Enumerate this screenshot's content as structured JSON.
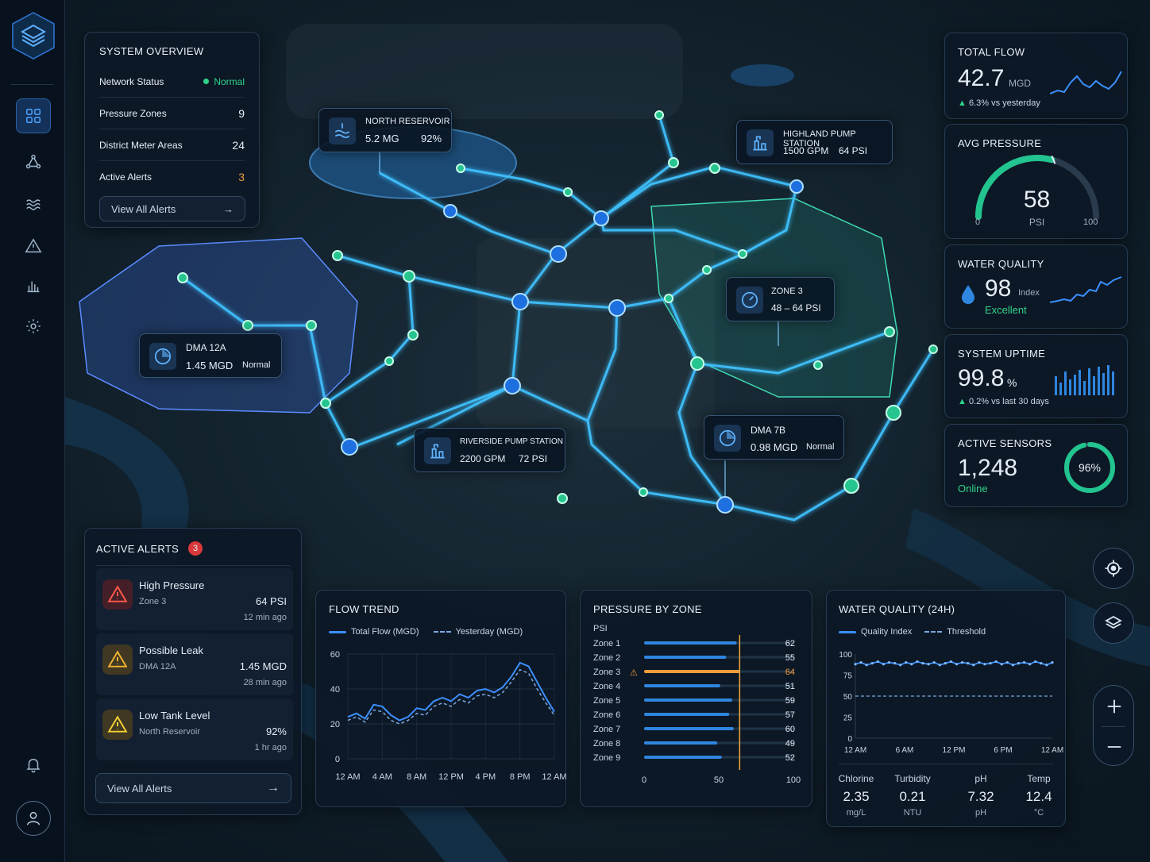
{
  "overview": {
    "title": "SYSTEM OVERVIEW",
    "rows": [
      {
        "label": "Network Status",
        "value": "Normal"
      },
      {
        "label": "Pressure Zones",
        "value": "9"
      },
      {
        "label": "District Meter Areas",
        "value": "24"
      },
      {
        "label": "Active Alerts",
        "value": "3"
      }
    ],
    "view_alerts": "View All Alerts"
  },
  "callouts": {
    "north_reservoir": {
      "title": "NORTH RESERVOIR",
      "volume": "5.2 MG",
      "level": "92%"
    },
    "highland": {
      "title": "HIGHLAND PUMP STATION",
      "flow": "1500 GPM",
      "pressure": "64 PSI"
    },
    "zone3": {
      "title": "ZONE 3",
      "range": "48 – 64 PSI"
    },
    "dma12a": {
      "title": "DMA 12A",
      "flow": "1.45 MGD",
      "status": "Normal"
    },
    "riverside": {
      "title": "RIVERSIDE PUMP STATION",
      "flow": "2200 GPM",
      "pressure": "72 PSI"
    },
    "dma7b": {
      "title": "DMA 7B",
      "flow": "0.98 MGD",
      "status": "Normal"
    }
  },
  "metrics": {
    "total_flow": {
      "title": "TOTAL FLOW",
      "value": "42.7",
      "unit": "MGD",
      "delta": "6.3% vs yesterday"
    },
    "avg_pressure": {
      "title": "AVG PRESSURE",
      "value": "58",
      "unit": "PSI",
      "min": "0",
      "max": "100",
      "level": 58
    },
    "water_quality": {
      "title": "WATER QUALITY",
      "value": "98",
      "unit": "Index",
      "status": "Excellent"
    },
    "uptime": {
      "title": "SYSTEM UPTIME",
      "value": "99.8",
      "unit": "%",
      "delta": "0.2% vs last 30 days"
    },
    "sensors": {
      "title": "ACTIVE SENSORS",
      "value": "1,248",
      "status": "Online",
      "percent": "96%",
      "fraction": 0.96
    }
  },
  "alerts": {
    "title": "ACTIVE ALERTS",
    "count": "3",
    "items": [
      {
        "name": "High Pressure",
        "zone": "Zone 3",
        "value": "64 PSI",
        "time": "12 min ago"
      },
      {
        "name": "Possible Leak",
        "zone": "DMA 12A",
        "value": "1.45 MGD",
        "time": "28 min ago"
      },
      {
        "name": "Low Tank Level",
        "zone": "North Reservoir",
        "value": "92%",
        "time": "1 hr ago"
      }
    ],
    "view_all": "View All Alerts"
  },
  "flow_trend": {
    "title": "FLOW TREND",
    "legend_total": "Total Flow (MGD)",
    "legend_yesterday": "Yesterday (MGD)"
  },
  "pressure_zone": {
    "title": "PRESSURE BY ZONE",
    "unit": "PSI"
  },
  "water_quality_24h": {
    "title": "WATER QUALITY (24H)",
    "legend_index": "Quality Index",
    "legend_threshold": "Threshold",
    "params": [
      {
        "name": "Chlorine",
        "value": "2.35",
        "unit": "mg/L"
      },
      {
        "name": "Turbidity",
        "value": "0.21",
        "unit": "NTU"
      },
      {
        "name": "pH",
        "value": "7.32",
        "unit": "pH"
      },
      {
        "name": "Temp",
        "value": "12.4",
        "unit": "°C"
      }
    ]
  },
  "chart_data": [
    {
      "type": "line",
      "x": [
        "12 AM",
        "4 AM",
        "8 AM",
        "12 PM",
        "4 PM",
        "8 PM",
        "12 AM"
      ],
      "ylim": [
        0,
        60
      ],
      "yticks": [
        0,
        20,
        40,
        60
      ],
      "series": [
        {
          "name": "Total Flow (MGD)",
          "values": [
            24,
            26,
            23,
            31,
            30,
            25,
            22,
            24,
            29,
            28,
            33,
            35,
            33,
            37,
            35,
            39,
            40,
            38,
            41,
            47,
            55,
            53,
            44,
            35,
            27
          ]
        },
        {
          "name": "Yesterday (MGD)",
          "values": [
            22,
            24,
            21,
            28,
            27,
            22,
            20,
            22,
            26,
            25,
            30,
            32,
            30,
            34,
            32,
            36,
            37,
            35,
            38,
            44,
            51,
            49,
            40,
            32,
            25
          ]
        }
      ]
    },
    {
      "type": "bar",
      "categories": [
        "Zone 1",
        "Zone 2",
        "Zone 3",
        "Zone 4",
        "Zone 5",
        "Zone 6",
        "Zone 7",
        "Zone 8",
        "Zone 9"
      ],
      "values": [
        62,
        55,
        64,
        51,
        59,
        57,
        60,
        49,
        52
      ],
      "xlim": [
        0,
        100
      ],
      "xticks": [
        0,
        50,
        100
      ],
      "threshold": 64
    },
    {
      "type": "line",
      "x": [
        "12 AM",
        "6 AM",
        "12 PM",
        "6 PM",
        "12 AM"
      ],
      "ylim": [
        0,
        100
      ],
      "yticks": [
        0,
        25,
        50,
        75,
        100
      ],
      "series": [
        {
          "name": "Quality Index",
          "values": [
            88,
            90,
            87,
            89,
            91,
            88,
            90,
            89,
            87,
            90,
            88,
            91,
            89,
            88,
            90,
            87,
            89,
            91,
            88,
            90,
            89,
            87,
            90,
            88,
            89,
            91,
            88,
            90,
            87,
            89,
            90,
            88,
            91,
            89,
            87,
            90
          ]
        },
        {
          "name": "Threshold",
          "values": [
            50,
            50
          ]
        }
      ]
    }
  ]
}
